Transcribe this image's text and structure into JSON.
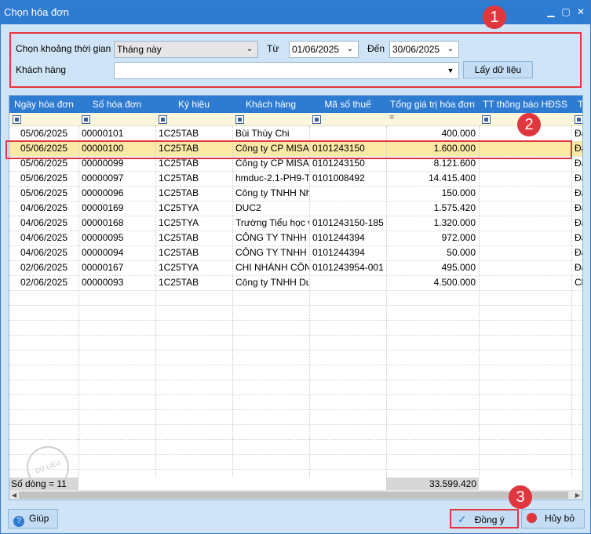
{
  "window": {
    "title": "Chọn hóa đơn"
  },
  "filter": {
    "period_label": "Chọn khoảng thời gian",
    "period_value": "Tháng này",
    "from_label": "Từ",
    "from_value": "01/06/2025",
    "to_label": "Đến",
    "to_value": "30/06/2025",
    "customer_label": "Khách hàng",
    "customer_value": "",
    "fetch_button": "Lấy dữ liệu"
  },
  "table": {
    "columns": [
      "Ngày hóa đơn",
      "Số hóa đơn",
      "Ký hiệu",
      "Khách hàng",
      "Mã số thuế",
      "Tổng giá trị hóa đơn",
      "TT thông báo HĐSS",
      "T"
    ],
    "rows": [
      [
        "05/06/2025",
        "00000101",
        "1C25TAB",
        "Bùi Thùy Chi",
        "",
        "400.000",
        "",
        "Đã"
      ],
      [
        "05/06/2025",
        "00000100",
        "1C25TAB",
        "Công ty CP MISA",
        "0101243150",
        "1.600.000",
        "",
        "Đã"
      ],
      [
        "05/06/2025",
        "00000099",
        "1C25TAB",
        "Công ty CP MISA",
        "0101243150",
        "8.121.600",
        "",
        "Đã"
      ],
      [
        "05/06/2025",
        "00000097",
        "1C25TAB",
        "hmduc-2.1-PH9-T",
        "0101008492",
        "14.415.400",
        "",
        "Đã"
      ],
      [
        "05/06/2025",
        "00000096",
        "1C25TAB",
        "Công ty TNHH Nh",
        "",
        "150.000",
        "",
        "Đã"
      ],
      [
        "04/06/2025",
        "00000169",
        "1C25TYA",
        "DUC2",
        "",
        "1.575.420",
        "",
        "Đã"
      ],
      [
        "04/06/2025",
        "00000168",
        "1C25TYA",
        "Trường Tiểu học v",
        "0101243150-185",
        "1.320.000",
        "",
        "Đã"
      ],
      [
        "04/06/2025",
        "00000095",
        "1C25TAB",
        "CÔNG TY TNHH",
        "0101244394",
        "972.000",
        "",
        "Đã"
      ],
      [
        "04/06/2025",
        "00000094",
        "1C25TAB",
        "CÔNG TY TNHH",
        "0101244394",
        "50.000",
        "",
        "Đã"
      ],
      [
        "02/06/2025",
        "00000167",
        "1C25TYA",
        "CHI NHÁNH CÔN",
        "0101243954-001",
        "495.000",
        "",
        "Đã"
      ],
      [
        "02/06/2025",
        "00000093",
        "1C25TAB",
        "Công ty TNHH Dư",
        "",
        "4.500.000",
        "",
        "Ch"
      ]
    ],
    "selected_row": 1,
    "row_count_label": "Số dòng = 11",
    "total_value": "33.599.420"
  },
  "watermark": "DỮ LIỆU MẪU",
  "badges": [
    "1",
    "2",
    "3"
  ],
  "buttons": {
    "help": "Giúp",
    "ok": "Đồng ý",
    "cancel": "Hủy bỏ"
  },
  "colors": {
    "accent": "#2e7bd2",
    "highlight": "#e0373f",
    "selected_row": "#fde9a6"
  }
}
